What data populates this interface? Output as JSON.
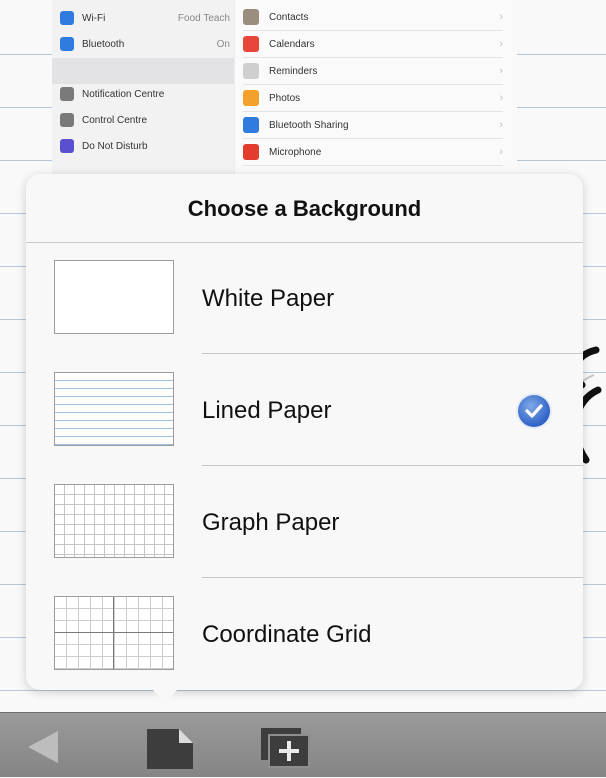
{
  "settings_shot": {
    "left_items": [
      {
        "label": "Wi-Fi",
        "value": "Food Teach",
        "color": "#2f7be0"
      },
      {
        "label": "Bluetooth",
        "value": "On",
        "color": "#2f7be0"
      },
      {
        "label": "Notification Centre",
        "value": "",
        "color": "#7a7a7a"
      },
      {
        "label": "Control Centre",
        "value": "",
        "color": "#7a7a7a"
      },
      {
        "label": "Do Not Disturb",
        "value": "",
        "color": "#5a4fcf"
      }
    ],
    "right_items": [
      {
        "label": "Contacts",
        "color": "#9a8f7e"
      },
      {
        "label": "Calendars",
        "color": "#e8463a"
      },
      {
        "label": "Reminders",
        "color": "#cfcfcf"
      },
      {
        "label": "Photos",
        "color": "#f3a12b"
      },
      {
        "label": "Bluetooth Sharing",
        "color": "#2f7be0"
      },
      {
        "label": "Microphone",
        "color": "#e33b2e"
      }
    ]
  },
  "popover": {
    "title": "Choose a Background",
    "options": [
      {
        "label": "White Paper",
        "thumb": "white",
        "selected": false
      },
      {
        "label": "Lined Paper",
        "thumb": "lined",
        "selected": true
      },
      {
        "label": "Graph Paper",
        "thumb": "graph",
        "selected": false
      },
      {
        "label": "Coordinate Grid",
        "thumb": "coord",
        "selected": false
      }
    ]
  },
  "toolbar": {
    "buttons": [
      {
        "name": "back-arrow-icon"
      },
      {
        "name": "page-icon"
      },
      {
        "name": "add-page-icon"
      }
    ]
  },
  "colors": {
    "accent": "#2f63c7",
    "toolbar": "#8e8e8e"
  }
}
